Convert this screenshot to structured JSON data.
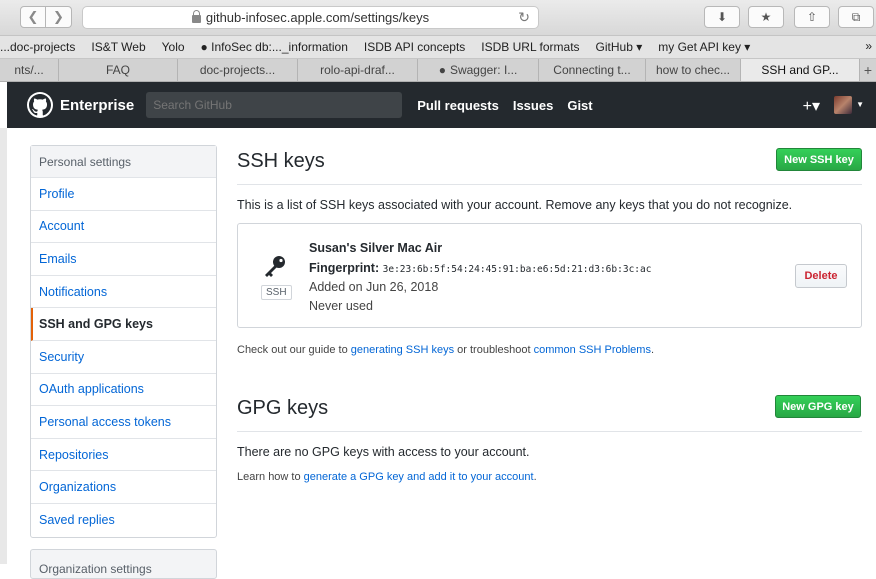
{
  "browser": {
    "url": "github-infosec.apple.com/settings/keys",
    "bookmarks": [
      "...doc-projects",
      "IS&T Web",
      "Yolo",
      "InfoSec db:..._information",
      "ISDB API concepts",
      "ISDB URL formats",
      "GitHub ▾",
      "my Get API key ▾"
    ],
    "tabs": [
      "nts/...",
      "FAQ",
      "doc-projects...",
      "rolo-api-draf...",
      "Swagger: I...",
      "Connecting t...",
      "how to chec...",
      "SSH and GP..."
    ],
    "active_tab_index": 7
  },
  "header": {
    "brand": "Enterprise",
    "search_placeholder": "Search GitHub",
    "nav": [
      "Pull requests",
      "Issues",
      "Gist"
    ],
    "plus": "+▾"
  },
  "sidebar": {
    "heading": "Personal settings",
    "items": [
      "Profile",
      "Account",
      "Emails",
      "Notifications",
      "SSH and GPG keys",
      "Security",
      "OAuth applications",
      "Personal access tokens",
      "Repositories",
      "Organizations",
      "Saved replies"
    ],
    "selected_index": 4,
    "second_heading": "Organization settings"
  },
  "ssh": {
    "title": "SSH keys",
    "new_button": "New SSH key",
    "description": "This is a list of SSH keys associated with your account. Remove any keys that you do not recognize.",
    "key": {
      "name": "Susan's Silver Mac Air",
      "fingerprint_label": "Fingerprint:",
      "fingerprint": "3e:23:6b:5f:54:24:45:91:ba:e6:5d:21:d3:6b:3c:ac",
      "added": "Added on Jun 26, 2018",
      "usage": "Never used",
      "badge": "SSH",
      "delete_label": "Delete"
    },
    "guide": {
      "pre": "Check out our guide to ",
      "link1": "generating SSH keys",
      "mid": " or troubleshoot ",
      "link2": "common SSH Problems",
      "post": "."
    }
  },
  "gpg": {
    "title": "GPG keys",
    "new_button": "New GPG key",
    "empty": "There are no GPG keys with access to your account.",
    "learn": {
      "pre": "Learn how to ",
      "link": "generate a GPG key and add it to your account",
      "post": "."
    }
  }
}
